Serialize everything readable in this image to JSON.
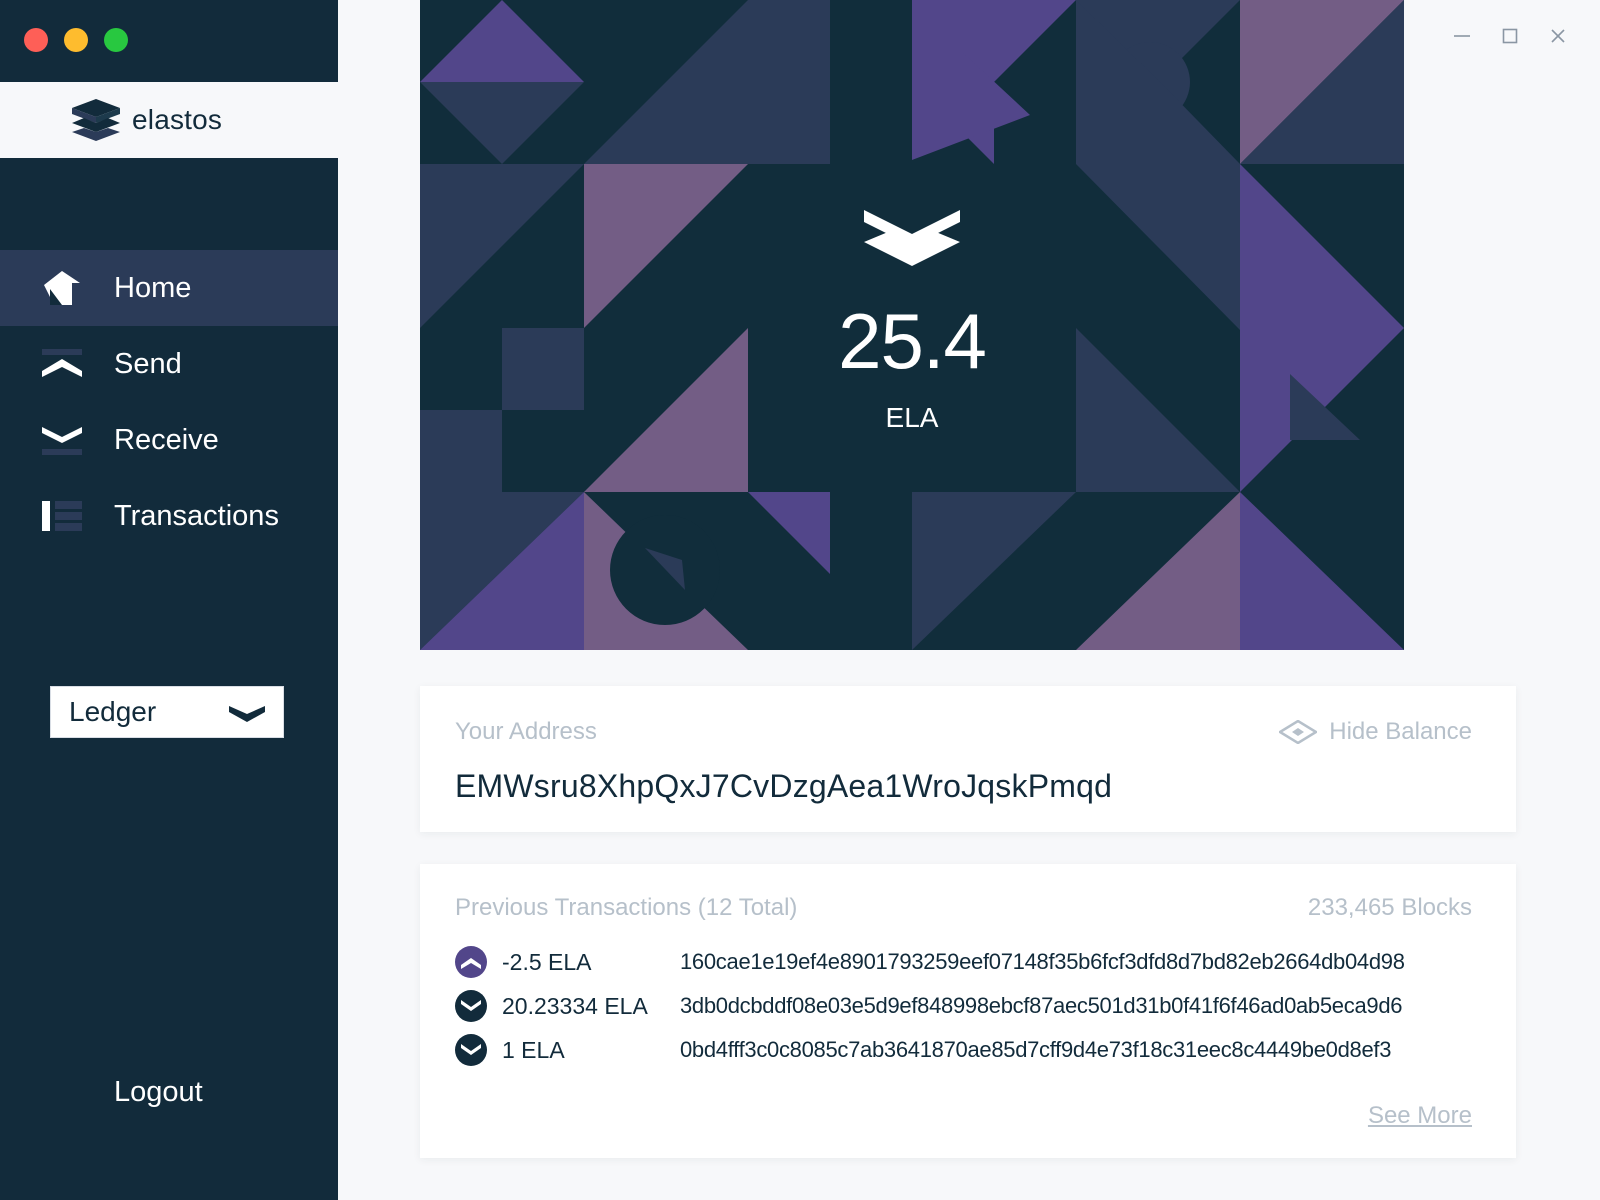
{
  "app": {
    "brand": "elastos"
  },
  "colors": {
    "sidebar_bg": "#122b3b",
    "active_item_bg": "#2b3b58",
    "banner_bg": "#112d3b",
    "purple": "#52468a",
    "mauve": "#735d85",
    "slate": "#2b3b58",
    "muted_text": "#b6c0ca",
    "traffic_close": "#fe5f57",
    "traffic_minimize": "#febc2e",
    "traffic_maximize": "#28c840"
  },
  "sidebar": {
    "items": [
      {
        "label": "Home",
        "icon": "home-icon",
        "active": true
      },
      {
        "label": "Send",
        "icon": "send-icon",
        "active": false
      },
      {
        "label": "Receive",
        "icon": "receive-icon",
        "active": false
      },
      {
        "label": "Transactions",
        "icon": "transactions-icon",
        "active": false
      }
    ],
    "wallet_select": {
      "value": "Ledger"
    },
    "logout_label": "Logout"
  },
  "balance": {
    "amount": "25.4",
    "unit": "ELA"
  },
  "address_card": {
    "label": "Your Address",
    "address": "EMWsru8XhpQxJ7CvDzgAea1WroJqskPmqd",
    "hide_balance_label": "Hide Balance"
  },
  "transactions_card": {
    "title": "Previous Transactions (12 Total)",
    "blocks": "233,465 Blocks",
    "rows": [
      {
        "amount": "-2.5 ELA",
        "hash": "160cae1e19ef4e8901793259eef07148f35b6fcf3dfd8d7bd82eb2664db04d98",
        "direction": "sent"
      },
      {
        "amount": "20.23334 ELA",
        "hash": "3db0dcbddf08e03e5d9ef848998ebcf87aec501d31b0f41f6f46ad0ab5eca9d6",
        "direction": "received"
      },
      {
        "amount": "1 ELA",
        "hash": "0bd4fff3c0c8085c7ab3641870ae85d7cff9d4e73f18c31eec8c4449be0d8ef3",
        "direction": "received"
      }
    ],
    "see_more_label": "See More"
  }
}
